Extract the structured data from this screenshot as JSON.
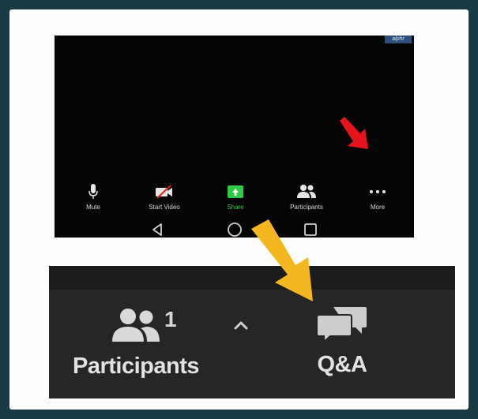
{
  "phone": {
    "badge": "alphr",
    "toolbar": [
      {
        "label": "Mute",
        "icon": "microphone-icon"
      },
      {
        "label": "Start Video",
        "icon": "video-off-icon"
      },
      {
        "label": "Share",
        "icon": "share-screen-icon"
      },
      {
        "label": "Participants",
        "icon": "participants-icon"
      },
      {
        "label": "More",
        "icon": "more-dots-icon"
      }
    ],
    "navbar": [
      "back-triangle-icon",
      "home-circle-icon",
      "recents-square-icon"
    ]
  },
  "zoombar": {
    "participants": {
      "label": "Participants",
      "count": "1",
      "icon": "participants-icon"
    },
    "caret_icon": "chevron-up-icon",
    "qa": {
      "label": "Q&A",
      "icon": "qa-speech-bubbles-icon"
    }
  },
  "annotations": {
    "red_arrow": "red-pointer-arrow-icon",
    "yellow_arrow": "yellow-pointer-arrow-icon"
  },
  "colors": {
    "background": "#173a45",
    "phone": "#050505",
    "zoombar": "#262626",
    "share_green": "#2ecb47",
    "red_arrow": "#e8141c",
    "yellow_arrow": "#f3b81f"
  }
}
